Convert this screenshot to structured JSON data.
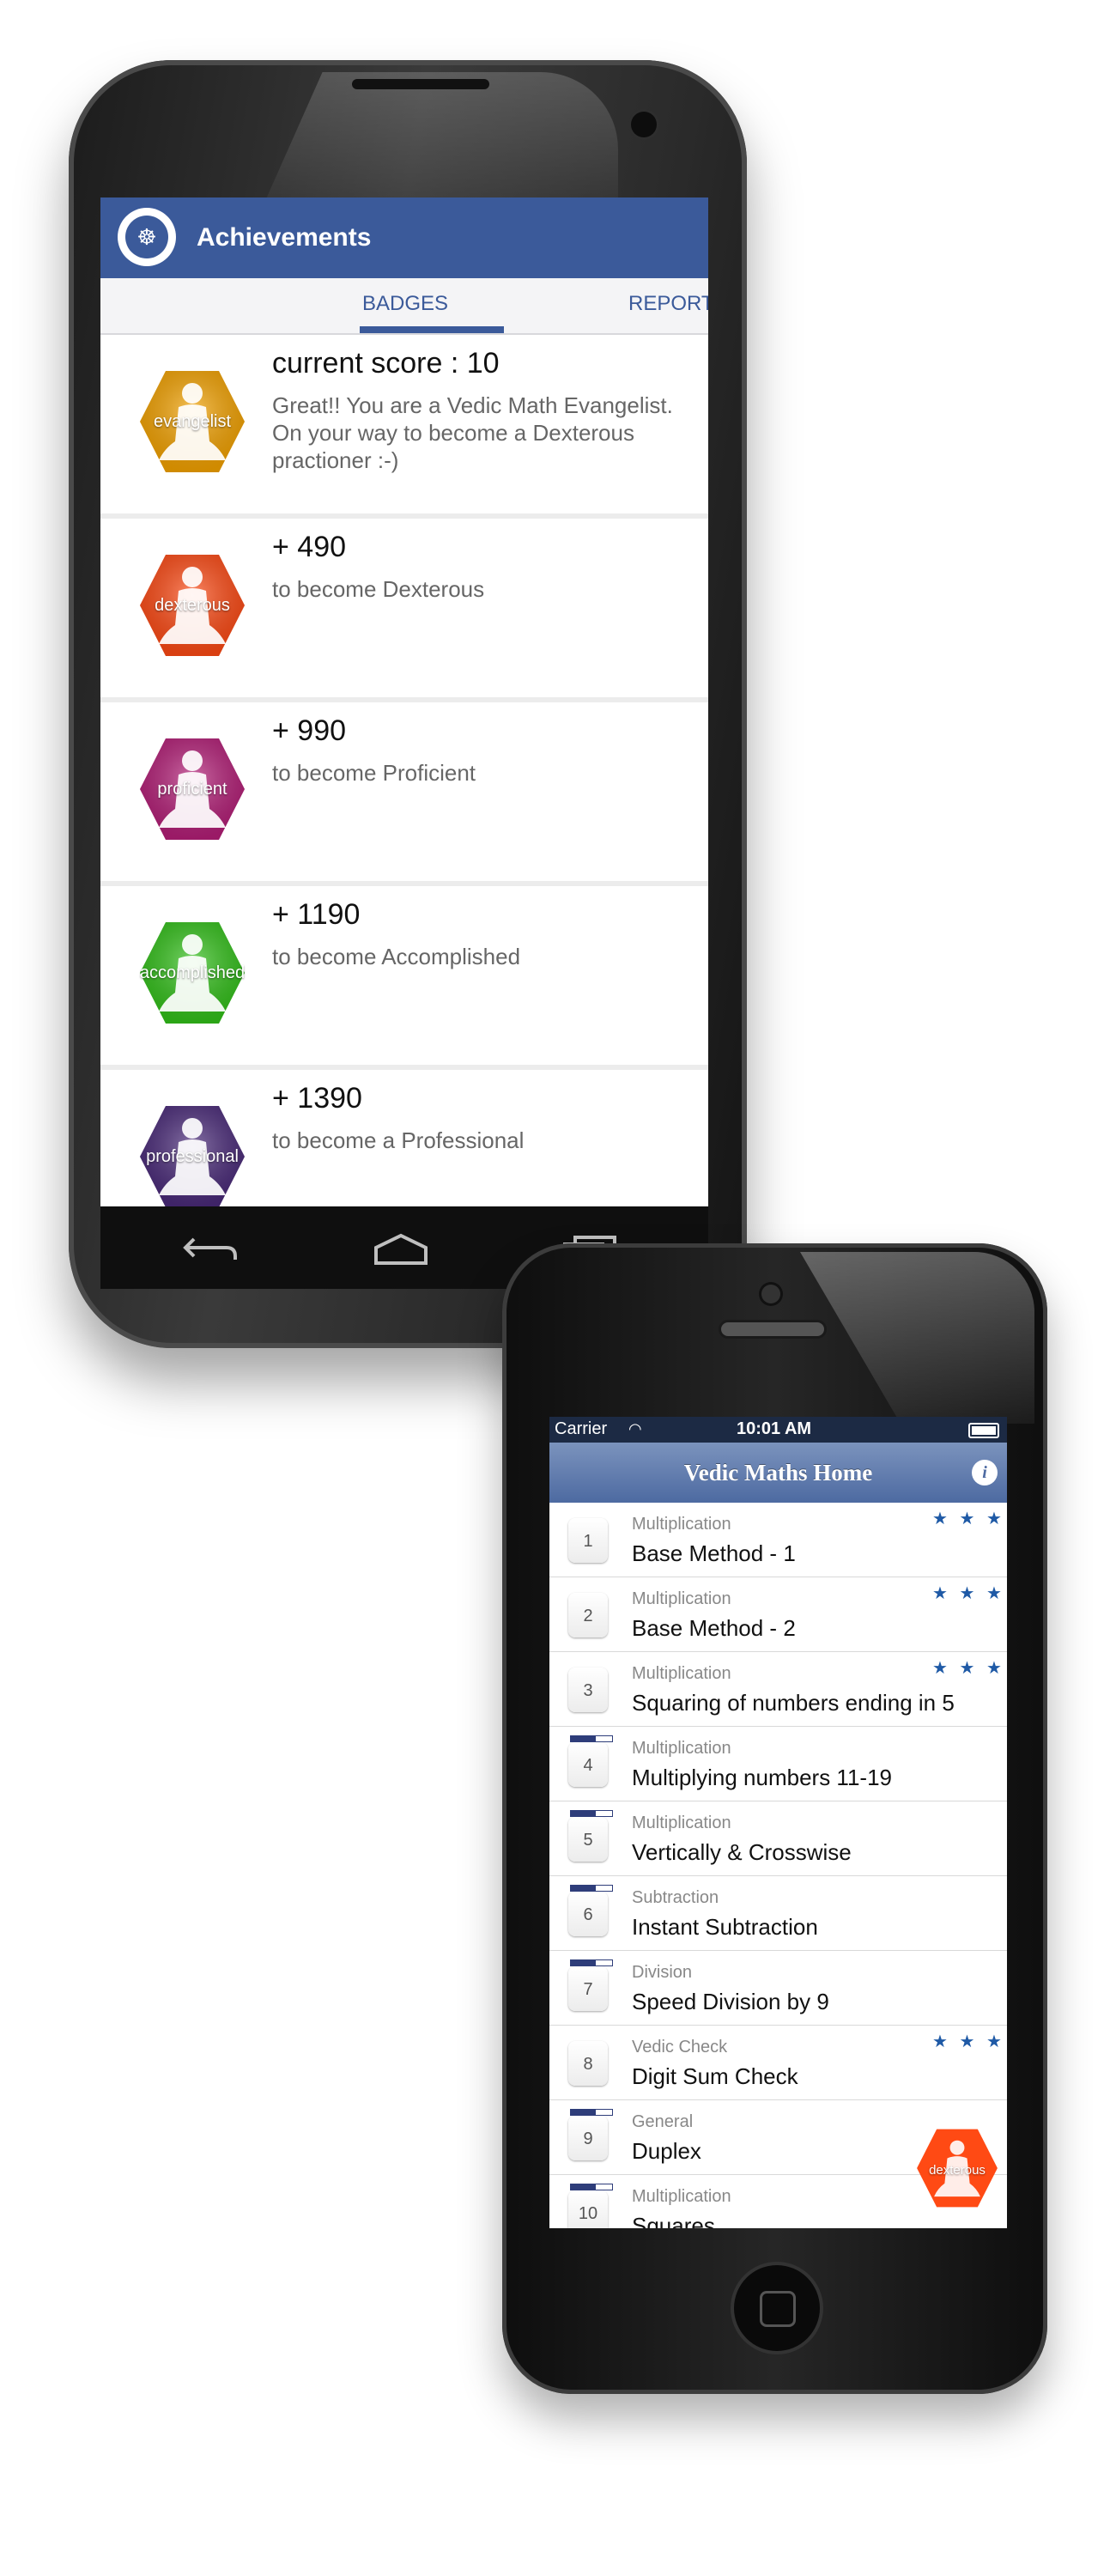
{
  "android": {
    "appbar": {
      "title": "Achievements",
      "logo": "meditating-figure-logo"
    },
    "tabs": [
      {
        "label": "BADGES",
        "selected": true
      },
      {
        "label": "REPORT",
        "selected": false
      }
    ],
    "badges": [
      {
        "label": "evangelist",
        "title": "current score : 10",
        "desc": "Great!! You are a Vedic Math Evangelist. On your way to become a Dexterous practioner :-)",
        "color": "#f5a300"
      },
      {
        "label": "dexterous",
        "title": "+ 490",
        "desc": "to become Dexterous",
        "color": "#ff4a14"
      },
      {
        "label": "proficient",
        "title": "+ 990",
        "desc": "to become Proficient",
        "color": "#b51e78"
      },
      {
        "label": "accomplished",
        "title": "+ 1190",
        "desc": "to become Accomplished",
        "color": "#33c21a"
      },
      {
        "label": "professional",
        "title": "+ 1390",
        "desc": "to become a Professional",
        "color": "#4a2a7a"
      }
    ],
    "navbar": {
      "icons": [
        "back-icon",
        "home-icon",
        "recent-apps-icon"
      ]
    }
  },
  "iphone": {
    "status": {
      "carrier": "Carrier",
      "time": "10:01 AM"
    },
    "navbar": {
      "title": "Vedic Maths Home",
      "info": "i"
    },
    "lessons": [
      {
        "num": "1",
        "category": "Multiplication",
        "name": "Base Method - 1",
        "stars": "★ ★ ★",
        "progress": null
      },
      {
        "num": "2",
        "category": "Multiplication",
        "name": "Base Method - 2",
        "stars": "★ ★ ★",
        "progress": null
      },
      {
        "num": "3",
        "category": "Multiplication",
        "name": "Squaring of numbers ending in 5",
        "stars": "★ ★ ★",
        "progress": null
      },
      {
        "num": "4",
        "category": "Multiplication",
        "name": "Multiplying numbers 11-19",
        "stars": "",
        "progress": 0.6
      },
      {
        "num": "5",
        "category": "Multiplication",
        "name": "Vertically & Crosswise",
        "stars": "",
        "progress": 0.6
      },
      {
        "num": "6",
        "category": "Subtraction",
        "name": "Instant Subtraction",
        "stars": "",
        "progress": 0.6
      },
      {
        "num": "7",
        "category": "Division",
        "name": "Speed Division by 9",
        "stars": "",
        "progress": 0.6
      },
      {
        "num": "8",
        "category": "Vedic Check",
        "name": "Digit Sum Check",
        "stars": "★ ★ ★",
        "progress": null
      },
      {
        "num": "9",
        "category": "General",
        "name": "Duplex",
        "stars": "",
        "progress": 0.6
      },
      {
        "num": "10",
        "category": "Multiplication",
        "name": "Squares",
        "stars": "",
        "progress": 0.6
      }
    ],
    "fab": {
      "label": "dexterous",
      "color": "#ff4a14"
    }
  }
}
